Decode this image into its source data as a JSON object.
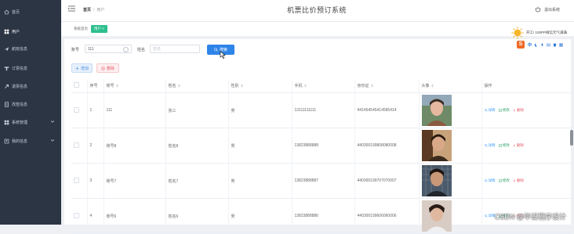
{
  "app": {
    "title": "机票比价预订系统",
    "logout_label": "退出系统"
  },
  "breadcrumb": {
    "home": "首页",
    "current": "用户"
  },
  "sidebar": {
    "items": [
      {
        "label": "首页",
        "icon": "home-icon",
        "expandable": false
      },
      {
        "label": "用户",
        "icon": "grid-icon",
        "expandable": false
      },
      {
        "label": "航班信息",
        "icon": "airplane-icon",
        "expandable": false
      },
      {
        "label": "订票信息",
        "icon": "ticket-icon",
        "expandable": false
      },
      {
        "label": "退票信息",
        "icon": "return-icon",
        "expandable": false
      },
      {
        "label": "改签信息",
        "icon": "doc-icon",
        "expandable": false
      },
      {
        "label": "系统管理",
        "icon": "grid-icon",
        "expandable": true
      },
      {
        "label": "我的信息",
        "icon": "user-icon",
        "expandable": true
      }
    ]
  },
  "tabs": {
    "home": "系统首页",
    "active": "用户",
    "close": "×"
  },
  "search": {
    "account_label": "账号",
    "account_value": "111",
    "name_label": "姓名",
    "name_placeholder": "姓名",
    "search_button": "搜索"
  },
  "actions": {
    "add": "增加",
    "delete": "删除"
  },
  "table": {
    "headers": [
      "",
      "序号",
      "账号",
      "姓名",
      "性别",
      "手机",
      "身份证",
      "头像",
      "操作"
    ],
    "rows": [
      {
        "index": "1",
        "account": "111",
        "name": "张三",
        "gender": "男",
        "phone": "13111111111",
        "id_card": "441454545414585414"
      },
      {
        "index": "2",
        "account": "账号8",
        "name": "姓名8",
        "gender": "男",
        "phone": "13823888888",
        "id_card": "440300199808080008"
      },
      {
        "index": "3",
        "account": "账号7",
        "name": "姓名7",
        "gender": "男",
        "phone": "13823888887",
        "id_card": "440300199707070007"
      },
      {
        "index": "4",
        "account": "账号6",
        "name": "姓名6",
        "gender": "男",
        "phone": "13823888886",
        "id_card": "440300199606060006"
      }
    ],
    "ops": {
      "detail": "详情",
      "edit": "修改",
      "delete": "删除"
    }
  },
  "overlay": {
    "weather_text": "开工! 100PP微信元气满满",
    "ime_letter": "S",
    "ime_mode": "中"
  },
  "watermark": "CSDN @毕设程序设计",
  "colors": {
    "sidebar_bg": "#2b3544",
    "primary": "#2f84e8",
    "tab_active": "#2fbf8f",
    "danger": "#e35d6a"
  }
}
